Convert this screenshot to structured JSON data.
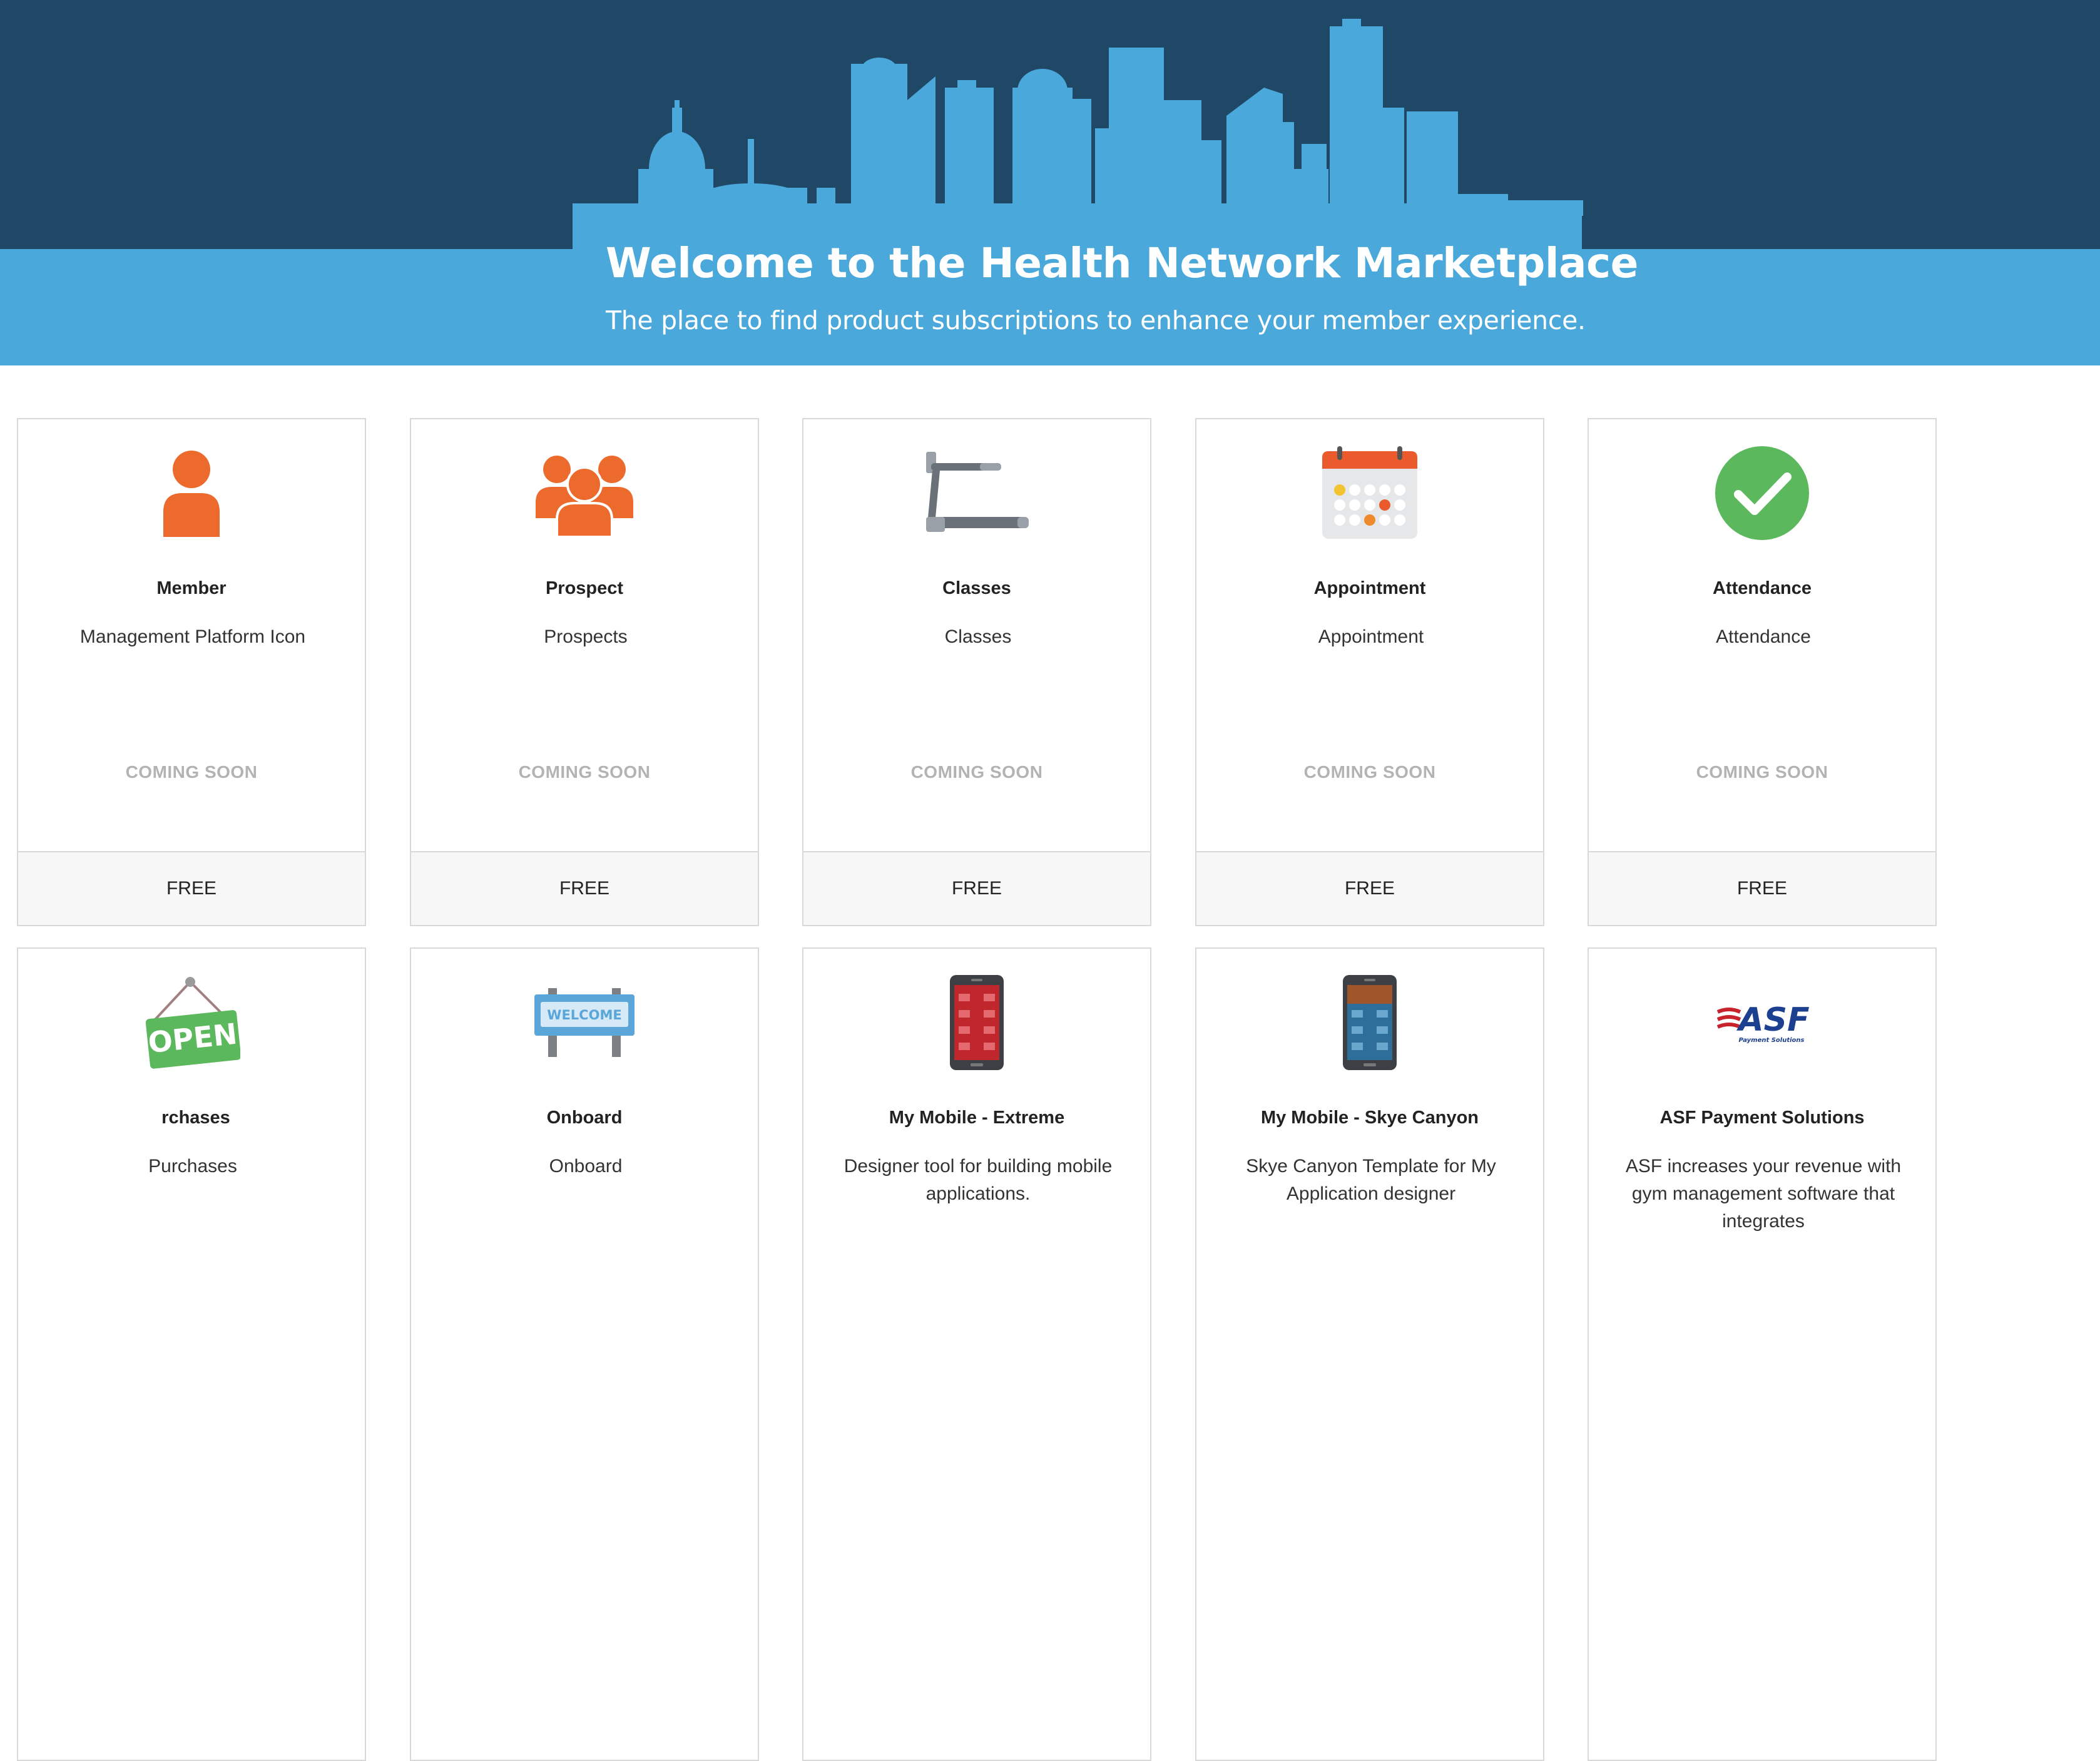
{
  "hero": {
    "title": "Welcome to the Health Network Marketplace",
    "subtitle": "The place to find  product subscriptions to enhance your member experience.",
    "colors": {
      "dark": "#1f4866",
      "band": "#4ba8da",
      "skyline": "#4ba8da"
    }
  },
  "cards": [
    {
      "icon": "member-person-icon",
      "title": "Member",
      "description": "Management Platform Icon",
      "status": "COMING SOON",
      "price": "FREE"
    },
    {
      "icon": "prospect-group-icon",
      "title": "Prospect",
      "description": "Prospects",
      "status": "COMING SOON",
      "price": "FREE"
    },
    {
      "icon": "treadmill-icon",
      "title": "Classes",
      "description": "Classes",
      "status": "COMING SOON",
      "price": "FREE"
    },
    {
      "icon": "calendar-icon",
      "title": "Appointment",
      "description": "Appointment",
      "status": "COMING SOON",
      "price": "FREE"
    },
    {
      "icon": "checkmark-circle-icon",
      "title": "Attendance",
      "description": "Attendance",
      "status": "COMING SOON",
      "price": "FREE"
    },
    {
      "icon": "open-sign-icon",
      "title": "rchases",
      "description": "Purchases",
      "sign_text": "OPEN"
    },
    {
      "icon": "welcome-sign-icon",
      "title": "Onboard",
      "description": "Onboard",
      "sign_text": "WELCOME"
    },
    {
      "icon": "mobile-phone-red-icon",
      "title": "My Mobile - Extreme",
      "description": "Designer tool for building mobile applications."
    },
    {
      "icon": "mobile-phone-blue-icon",
      "title": "My Mobile - Skye Canyon",
      "description": "Skye Canyon Template for My Application designer"
    },
    {
      "icon": "asf-logo-icon",
      "title": "ASF Payment Solutions",
      "description": "ASF increases your revenue with gym management software that integrates",
      "logo_text": "ASF",
      "logo_sub": "Payment Solutions"
    }
  ],
  "colors": {
    "orange": "#ec6a2c",
    "green": "#5cb85c",
    "border": "#d9d9d9",
    "status_gray": "#b3b3b3"
  }
}
